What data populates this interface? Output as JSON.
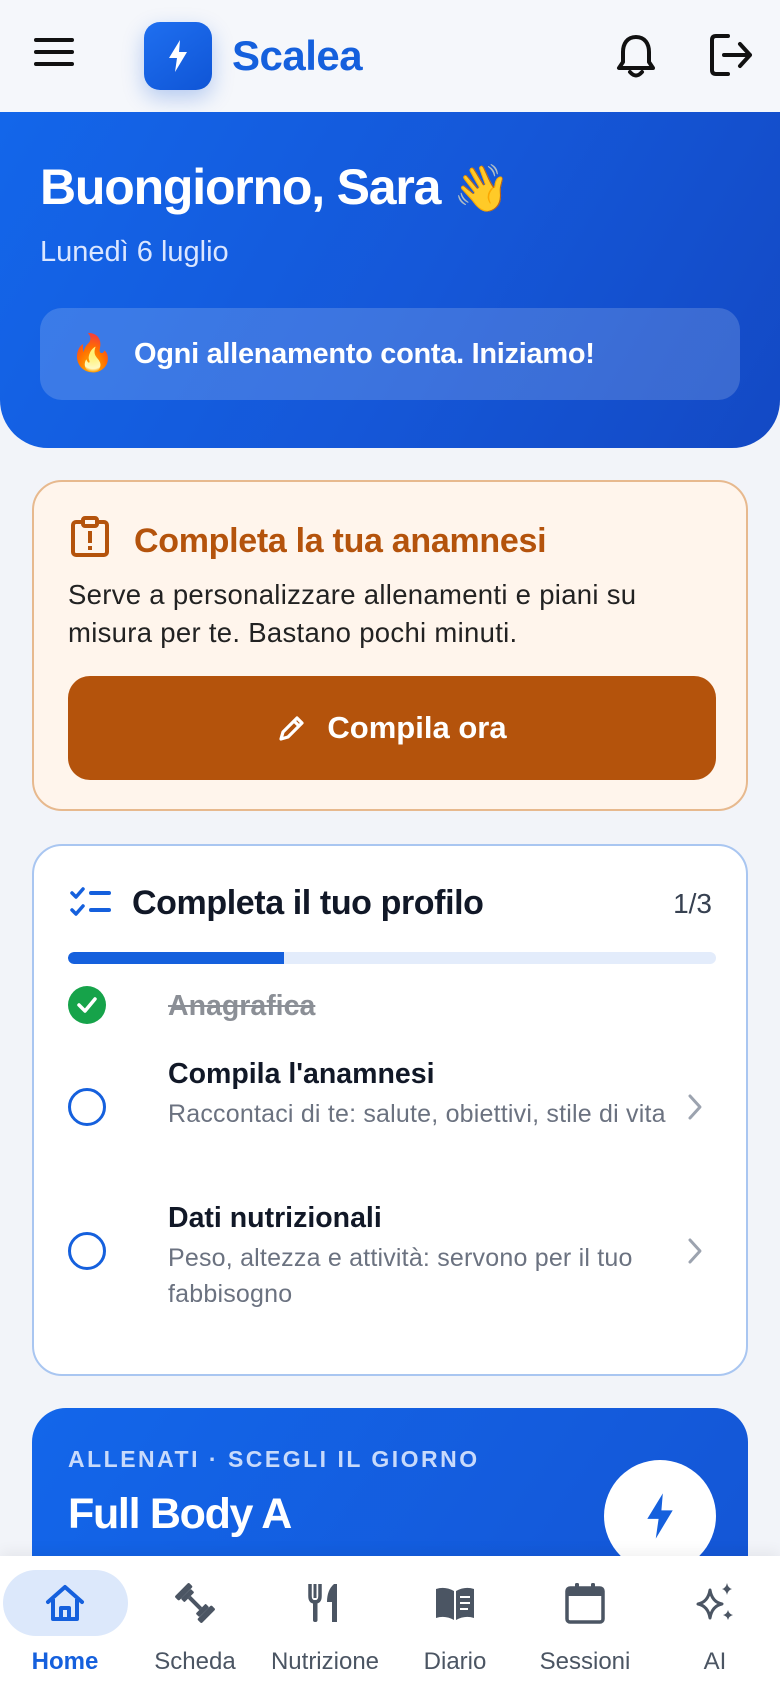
{
  "header": {
    "brand": "Scalea",
    "icons": {
      "menu": "menu-icon",
      "logo": "bolt-icon",
      "notifications": "bell-icon",
      "logout": "logout-icon"
    }
  },
  "hero": {
    "greeting": "Buongiorno, Sara",
    "greeting_emoji": "👋",
    "date": "Lunedì 6 luglio",
    "motto_emoji": "🔥",
    "motto": "Ogni allenamento conta. Iniziamo!"
  },
  "anamnesi_card": {
    "title": "Completa la tua anamnesi",
    "description": "Serve a personalizzare allenamenti e piani su misura per te. Bastano pochi minuti.",
    "button_label": "Compila ora",
    "accent_color": "#b4530c"
  },
  "profile_card": {
    "title": "Completa il tuo profilo",
    "count": "1/3",
    "progress": 0.333,
    "steps": [
      {
        "title": "Anagrafica",
        "done": true,
        "description": ""
      },
      {
        "title": "Compila l'anamnesi",
        "done": false,
        "description": "Raccontaci di te: salute, obiettivi, stile di vita"
      },
      {
        "title": "Dati nutrizionali",
        "done": false,
        "description": "Peso, altezza e attività: servono per il tuo fabbisogno"
      }
    ]
  },
  "workout_card": {
    "kicker": "ALLENATI · SCEGLI IL GIORNO",
    "title": "Full Body A"
  },
  "bottom_nav": {
    "items": [
      {
        "label": "Home",
        "icon": "home-icon",
        "active": true
      },
      {
        "label": "Scheda",
        "icon": "dumbbell-icon",
        "active": false
      },
      {
        "label": "Nutrizione",
        "icon": "fork-knife-icon",
        "active": false
      },
      {
        "label": "Diario",
        "icon": "book-icon",
        "active": false
      },
      {
        "label": "Sessioni",
        "icon": "calendar-icon",
        "active": false
      },
      {
        "label": "AI",
        "icon": "sparkles-icon",
        "active": false
      }
    ]
  },
  "colors": {
    "primary": "#1560dd",
    "success": "#16a34a",
    "warning": "#b4530c"
  }
}
